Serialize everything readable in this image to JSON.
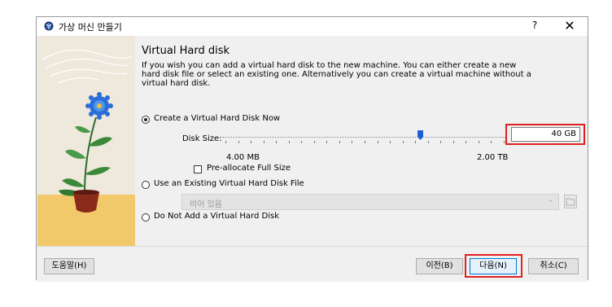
{
  "window": {
    "title": "가상 머신 만들기",
    "help_label": "?",
    "close_label": "✕"
  },
  "page": {
    "heading": "Virtual Hard disk",
    "description": "If you wish you can add a virtual hard disk to the new machine. You can either create a new hard disk file or select an existing one. Alternatively you can create a virtual machine without a virtual hard disk."
  },
  "options": {
    "create_new": {
      "label": "Create a Virtual Hard Disk Now",
      "selected": true
    },
    "use_existing": {
      "label": "Use an Existing Virtual Hard Disk File",
      "selected": false
    },
    "no_disk": {
      "label": "Do Not Add a Virtual Hard Disk",
      "selected": false
    }
  },
  "disk": {
    "size_label": "Disk Size:",
    "size_value": "40 GB",
    "slider_level": 0.7,
    "min_label": "4.00 MB",
    "max_label": "2.00 TB",
    "preallocate_label": "Pre-allocate Full Size",
    "preallocate_checked": false
  },
  "existing": {
    "combo_value": "비어 있음"
  },
  "footer": {
    "help_label": "도움말(H)",
    "back_label": "이전(B)",
    "next_label": "다음(N)",
    "cancel_label": "취소(C)"
  },
  "colors": {
    "highlight": "#e02020",
    "thumb": "#1e5fd6",
    "banner_floor": "#f2c96a"
  }
}
